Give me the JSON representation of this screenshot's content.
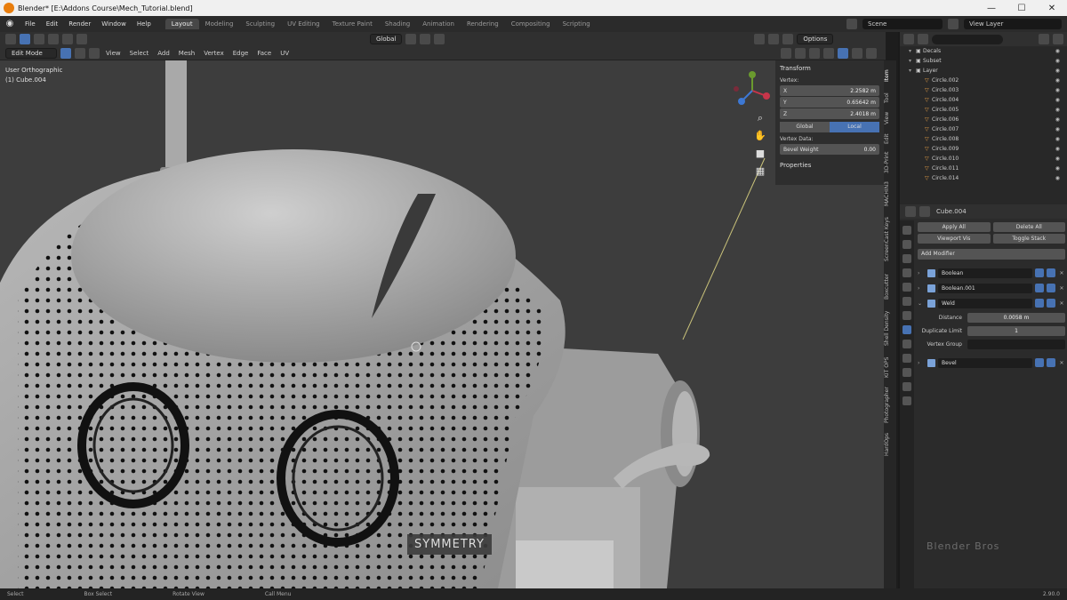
{
  "titlebar": {
    "title": "Blender* [E:\\Addons Course\\Mech_Tutorial.blend]",
    "min": "—",
    "max": "☐",
    "close": "✕"
  },
  "menu": [
    "File",
    "Edit",
    "Render",
    "Window",
    "Help"
  ],
  "workspaces": [
    "Layout",
    "Modeling",
    "Sculpting",
    "UV Editing",
    "Texture Paint",
    "Shading",
    "Animation",
    "Rendering",
    "Compositing",
    "Scripting"
  ],
  "active_workspace": "Layout",
  "scene_label": "Scene",
  "view_layer_label": "View Layer",
  "viewport_header": {
    "orientation": "Global",
    "options": "Options"
  },
  "mode_header": {
    "mode": "Edit Mode",
    "menus": [
      "View",
      "Select",
      "Add",
      "Mesh",
      "Vertex",
      "Edge",
      "Face",
      "UV"
    ]
  },
  "viewport": {
    "view_name": "User Orthographic",
    "object_label": "(1) Cube.004",
    "symmetry": "SYMMETRY"
  },
  "npanel": {
    "transform_heading": "Transform",
    "vertex_label": "Vertex:",
    "x": {
      "label": "X",
      "value": "2.2582 m"
    },
    "y": {
      "label": "Y",
      "value": "0.65642 m"
    },
    "z": {
      "label": "Z",
      "value": "2.4018 m"
    },
    "global": "Global",
    "local": "Local",
    "vertex_data": "Vertex Data:",
    "bevel_weight": {
      "label": "Bevel Weight",
      "value": "0.00"
    },
    "properties_heading": "Properties"
  },
  "vtabs": [
    "Item",
    "Tool",
    "View",
    "Edit",
    "3D-Print",
    "MACHIN3",
    "ScreenCast Keys",
    "Boxcutter",
    "Shell Density",
    "KIT OPS",
    "Photographer",
    "HardOps"
  ],
  "outliner": {
    "rows": [
      {
        "name": "Decals",
        "type": "collection"
      },
      {
        "name": "Subset",
        "type": "collection"
      },
      {
        "name": "Layer",
        "type": "collection"
      },
      {
        "name": "Circle.002",
        "type": "object"
      },
      {
        "name": "Circle.003",
        "type": "object"
      },
      {
        "name": "Circle.004",
        "type": "object"
      },
      {
        "name": "Circle.005",
        "type": "object"
      },
      {
        "name": "Circle.006",
        "type": "object"
      },
      {
        "name": "Circle.007",
        "type": "object"
      },
      {
        "name": "Circle.008",
        "type": "object"
      },
      {
        "name": "Circle.009",
        "type": "object"
      },
      {
        "name": "Circle.010",
        "type": "object"
      },
      {
        "name": "Circle.011",
        "type": "object"
      },
      {
        "name": "Circle.014",
        "type": "object"
      }
    ]
  },
  "properties": {
    "object_name": "Cube.004",
    "apply_all": "Apply All",
    "delete_all": "Delete All",
    "viewport_vis": "Viewport Vis",
    "toggle_stack": "Toggle Stack",
    "add_modifier": "Add Modifier",
    "modifiers": [
      {
        "name": "Boolean"
      },
      {
        "name": "Boolean.001"
      },
      {
        "name": "Weld"
      }
    ],
    "weld_distance": {
      "label": "Distance",
      "value": "0.0058 m"
    },
    "weld_duplicate_limit": {
      "label": "Duplicate Limit",
      "value": "1"
    },
    "weld_vertex_group": {
      "label": "Vertex Group"
    },
    "bevel": {
      "name": "Bevel"
    }
  },
  "statusbar": {
    "items": [
      "Select",
      "Box Select",
      "Rotate View",
      "Call Menu"
    ],
    "version": "2.90.0"
  },
  "watermark": "Blender Bros",
  "colors": {
    "accent": "#4772b3",
    "panel": "#2b2b2b",
    "viewport": "#3d3d3d"
  }
}
